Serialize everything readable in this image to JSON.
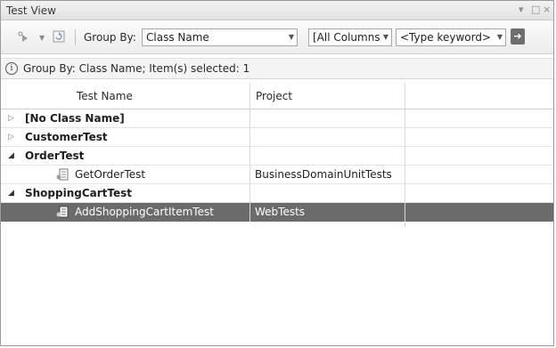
{
  "window": {
    "title": "Test View",
    "controls": [
      "▾",
      "□",
      "×"
    ]
  },
  "toolbar": {
    "run_icon": "run-tests-icon",
    "refresh_icon": "refresh-icon",
    "group_by_label": "Group By:",
    "group_by_value": "Class Name",
    "filter_column_value": "[All Columns]",
    "keyword_value": "<Type keyword>",
    "apply_filter_icon": "apply-filter-arrow-icon"
  },
  "infobar": {
    "icon": "info-icon",
    "text": "Group By: Class Name; Item(s) selected: 1"
  },
  "grid": {
    "columns": [
      "Test Name",
      "Project"
    ],
    "rows": [
      {
        "type": "group",
        "expanded": false,
        "name": "[No Class Name]"
      },
      {
        "type": "group",
        "expanded": false,
        "name": "CustomerTest"
      },
      {
        "type": "group",
        "expanded": true,
        "name": "OrderTest"
      },
      {
        "type": "test",
        "name": "GetOrderTest",
        "project": "BusinessDomainUnitTests",
        "selected": false
      },
      {
        "type": "group",
        "expanded": true,
        "name": "ShoppingCartTest"
      },
      {
        "type": "test",
        "name": "AddShoppingCartItemTest",
        "project": "WebTests",
        "selected": true
      }
    ]
  },
  "colors": {
    "selected_row": "#6b6b6b",
    "toolbar_bg": "#ececec"
  }
}
